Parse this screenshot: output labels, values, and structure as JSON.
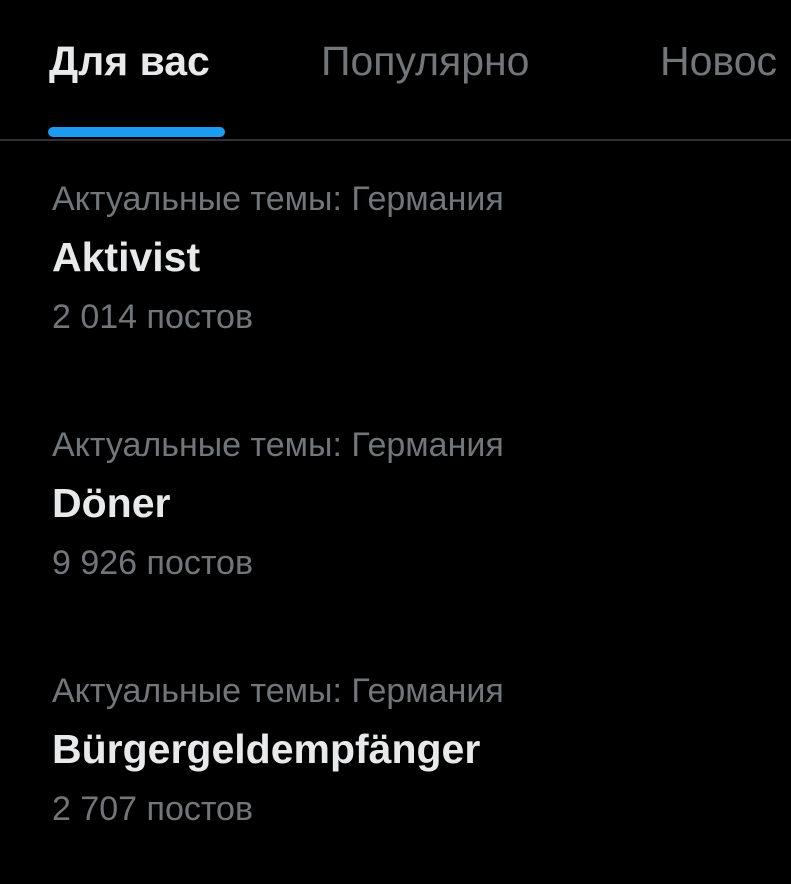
{
  "colors": {
    "background": "#000000",
    "accent": "#1d9bf0",
    "text_primary": "#e7e9ea",
    "text_secondary": "#71767b",
    "divider": "#2f3336"
  },
  "tabs": [
    {
      "label": "Для вас",
      "active": true
    },
    {
      "label": "Популярно",
      "active": false
    },
    {
      "label": "Новос",
      "active": false
    }
  ],
  "trends": [
    {
      "context": "Актуальные темы: Германия",
      "title": "Aktivist",
      "count": "2 014 постов"
    },
    {
      "context": "Актуальные темы: Германия",
      "title": "Döner",
      "count": "9 926 постов"
    },
    {
      "context": "Актуальные темы: Германия",
      "title": "Bürgergeldempfänger",
      "count": "2 707 постов"
    }
  ]
}
